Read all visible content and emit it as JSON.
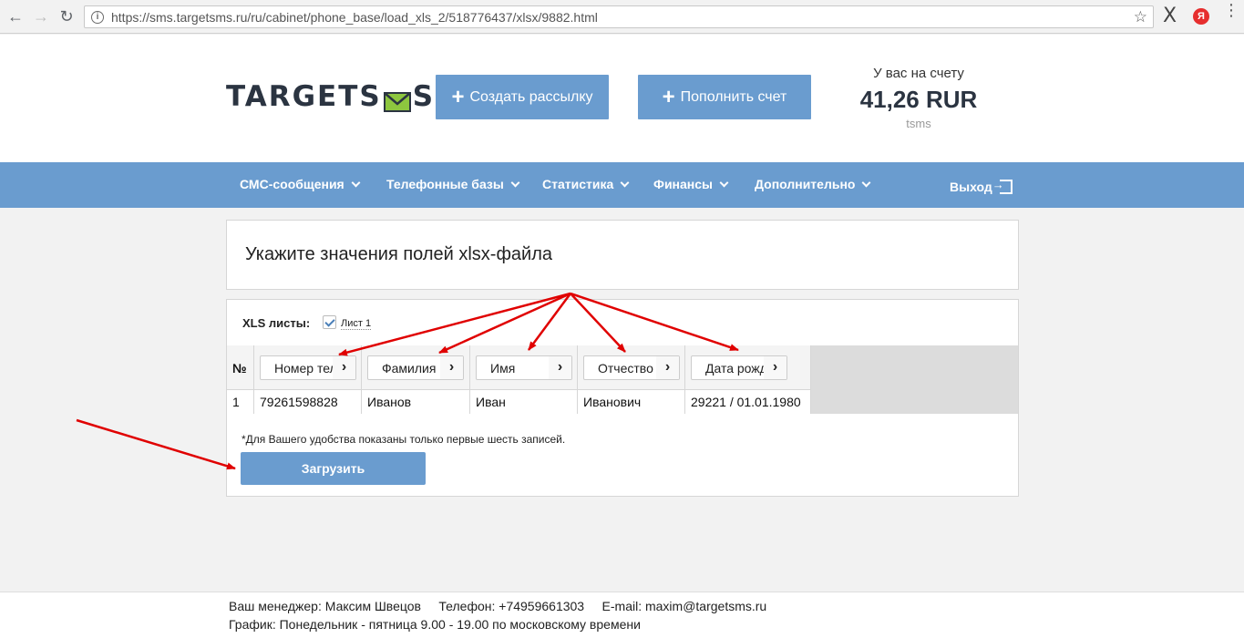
{
  "browser": {
    "url": "https://sms.targetsms.ru/ru/cabinet/phone_base/load_xls_2/518776437/xlsx/9882.html",
    "ext_x": "X",
    "ext_yandex": "Я",
    "back_glyph": "←",
    "forward_glyph": "→",
    "reload_glyph": "↻",
    "star_glyph": "☆",
    "menu_glyph": "⋮",
    "info_glyph": "i"
  },
  "header": {
    "logo_left": "TARGETS",
    "logo_right": "S",
    "create_button": "Создать рассылку",
    "topup_button": "Пополнить счет",
    "plus_glyph": "+",
    "balance_label": "У вас на счету",
    "balance_value": "41,26 RUR",
    "balance_sub": "tsms"
  },
  "menu": {
    "items": [
      "СМС-сообщения",
      "Телефонные базы",
      "Статистика",
      "Финансы",
      "Дополнительно"
    ],
    "logout": "Выход"
  },
  "main": {
    "title": "Укажите значения полей xlsx-файла",
    "sheets_label": "XLS листы:",
    "sheet_name": "Лист 1",
    "sheet_checked": true,
    "table": {
      "num_header": "№",
      "columns": [
        "Номер телефона",
        "Фамилия",
        "Имя",
        "Отчество",
        "Дата рождения"
      ],
      "arrow_glyph": "›",
      "rows": [
        [
          "1",
          "79261598828",
          "Иванов",
          "Иван",
          "Иванович",
          "29221 / 01.01.1980"
        ]
      ]
    },
    "note": "*Для Вашего удобства показаны только первые шесть записей.",
    "upload_button": "Загрузить"
  },
  "footer": {
    "line1": "Ваш менеджер: Максим Швецов     Телефон: +74959661303     E-mail: maxim@targetsms.ru",
    "line2": "График: Понедельник - пятница 9.00 - 19.00 по московскому времени"
  },
  "colors": {
    "accent": "#6a9ccf",
    "annotation": "#e00000",
    "logo_green": "#8dc63f"
  }
}
